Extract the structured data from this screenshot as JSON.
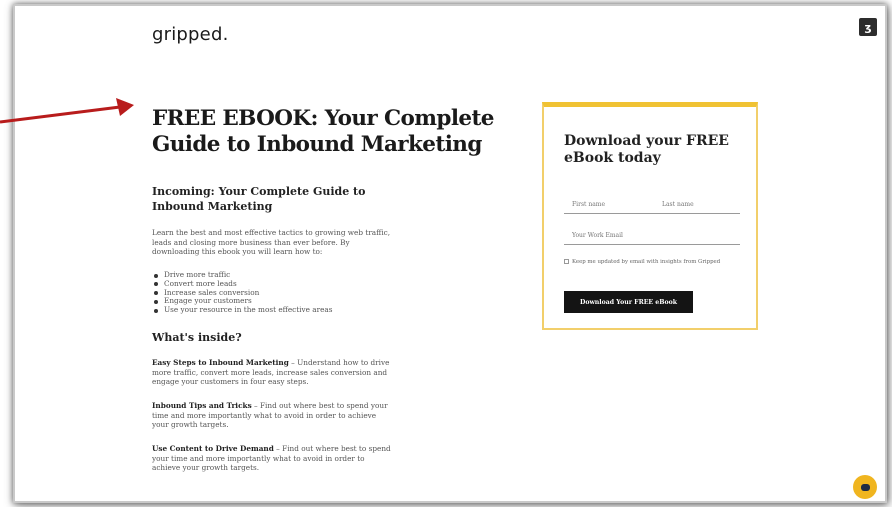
{
  "header": {
    "logo": "gripped.",
    "hub_icon": "hubspot-icon"
  },
  "main": {
    "title": "FREE EBOOK: Your Complete Guide to Inbound Marketing",
    "subheading": "Incoming: Your Complete Guide to Inbound Marketing",
    "intro": "Learn the best and most effective tactics to growing web traffic, leads and closing more business than ever before. By downloading this ebook you will learn how to:",
    "bullets": [
      "Drive more traffic",
      "Convert more leads",
      "Increase sales conversion",
      "Engage your customers",
      "Use your resource in the most effective areas"
    ],
    "inside_heading": "What's inside?",
    "sections": [
      {
        "heading": "Easy Steps to Inbound Marketing",
        "text": " – Understand how to drive more traffic, convert more leads, increase sales conversion and engage your customers in four easy steps."
      },
      {
        "heading": "Inbound Tips and Tricks",
        "text": " – Find out where best to spend your time and more importantly what to avoid in order to achieve your growth targets."
      },
      {
        "heading": "Use Content to Drive Demand",
        "text": " – Find out where best to spend your time and more importantly what to avoid in order to achieve your growth targets."
      }
    ]
  },
  "form": {
    "title": "Download your FREE eBook today",
    "first_name_placeholder": "First name",
    "last_name_placeholder": "Last name",
    "email_placeholder": "Your Work Email",
    "checkbox_label": "Keep me updated by email with insights from Gripped",
    "submit_label": "Download Your FREE eBook"
  },
  "colors": {
    "accent_yellow": "#f0c233",
    "arrow_red": "#b81c1c",
    "button_dark": "#141414"
  },
  "chat": {
    "icon": "chat-icon"
  }
}
